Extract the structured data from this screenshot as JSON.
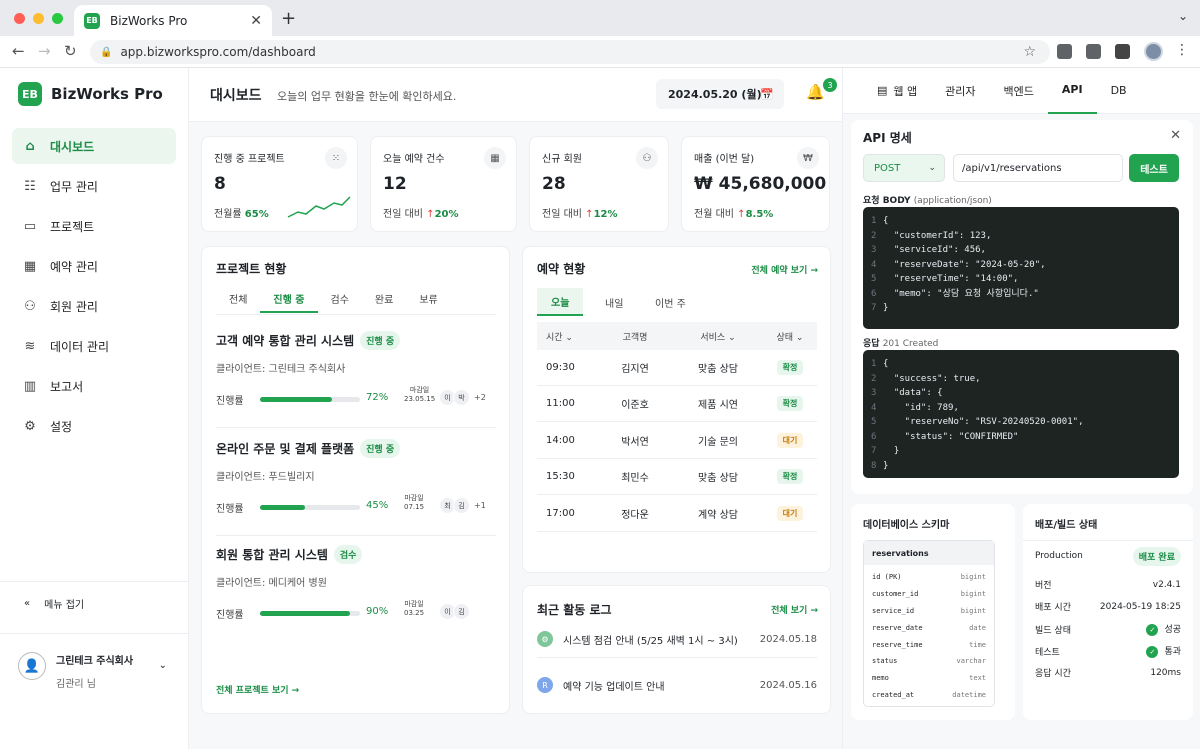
{
  "browser": {
    "tab_title": "BizWorks Pro",
    "url": "app.bizworkspro.com/dashboard"
  },
  "sidebar": {
    "brand": "BizWorks Pro",
    "brand_mark": "EB",
    "items": [
      {
        "label": "대시보드",
        "icon": "home-icon",
        "active": true
      },
      {
        "label": "업무 관리",
        "icon": "clipboard-icon"
      },
      {
        "label": "프로젝트",
        "icon": "folder-icon"
      },
      {
        "label": "예약 관리",
        "icon": "calendar-icon"
      },
      {
        "label": "회원 관리",
        "icon": "users-icon"
      },
      {
        "label": "데이터 관리",
        "icon": "database-icon"
      },
      {
        "label": "보고서",
        "icon": "chart-icon"
      },
      {
        "label": "설정",
        "icon": "gear-icon"
      }
    ],
    "collapse_label": "메뉴 접기",
    "company": "그린테크 주식회사",
    "user": "김관리 님"
  },
  "header": {
    "title": "대시보드",
    "subtitle": "오늘의 업무 현황을 한눈에 확인하세요.",
    "date": "2024.05.20 (월)",
    "notifications": "3"
  },
  "stats": [
    {
      "label": "진행 중 프로젝트",
      "value": "8",
      "cmp_label": "전월률",
      "cmp_value": "65%",
      "trend_up": false
    },
    {
      "label": "오늘 예약 건수",
      "value": "12",
      "cmp_label": "전일 대비",
      "cmp_value": "20%",
      "trend_up": true
    },
    {
      "label": "신규 회원",
      "value": "28",
      "cmp_label": "전일 대비",
      "cmp_value": "12%",
      "trend_up": true
    },
    {
      "label": "매출 (이번 달)",
      "value": "₩ 45,680,000",
      "cmp_label": "전월 대비",
      "cmp_value": "8.5%",
      "trend_up": true
    }
  ],
  "projects": {
    "title": "프로젝트 현황",
    "tabs": [
      "전체",
      "진행 중",
      "검수",
      "완료",
      "보류"
    ],
    "active_tab": 1,
    "progress_label": "진행률",
    "due_label": "마감일",
    "items": [
      {
        "name": "고객 예약 통합 관리 시스템",
        "status": "진행 중",
        "client": "클라이언트: 그린테크 주식회사",
        "progress": 72,
        "progress_text": "72%",
        "due": "23.05.15",
        "members": [
          "이",
          "박"
        ],
        "more": "+2"
      },
      {
        "name": "온라인 주문 및 결제 플랫폼",
        "status": "진행 중",
        "client": "클라이언트: 푸드빌리지",
        "progress": 45,
        "progress_text": "45%",
        "due": "07.15",
        "members": [
          "최",
          "김"
        ],
        "more": "+1"
      },
      {
        "name": "회원 통합 관리 시스템",
        "status": "검수",
        "client": "클라이언트: 메디케어 병원",
        "progress": 90,
        "progress_text": "90%",
        "due": "03.25",
        "members": [
          "이",
          "김"
        ],
        "more": ""
      }
    ],
    "view_all": "전체 프로젝트 보기 →"
  },
  "reservations": {
    "title": "예약 현황",
    "view_all": "전체 예약 보기 →",
    "tabs": [
      "오늘",
      "내일",
      "이번 주"
    ],
    "columns": [
      "시간 ⌄",
      "고객명",
      "서비스 ⌄",
      "상태 ⌄"
    ],
    "rows": [
      {
        "time": "09:30",
        "name": "김지연",
        "service": "맞춤 상담",
        "status": "확정"
      },
      {
        "time": "11:00",
        "name": "이준호",
        "service": "제품 시연",
        "status": "확정"
      },
      {
        "time": "14:00",
        "name": "박서연",
        "service": "기술 문의",
        "status": "대기"
      },
      {
        "time": "15:30",
        "name": "최민수",
        "service": "맞춤 상담",
        "status": "확정"
      },
      {
        "time": "17:00",
        "name": "정다운",
        "service": "계약 상담",
        "status": "대기"
      }
    ]
  },
  "activity": {
    "title": "최근 활동 로그",
    "view_all": "전체 보기 →",
    "items": [
      {
        "text": "시스템 점검 안내 (5/25 새벽 1시 ~ 3시)",
        "date": "2024.05.18",
        "badge": "⚙"
      },
      {
        "text": "예약 기능 업데이트 안내",
        "date": "2024.05.16",
        "badge": "R"
      }
    ]
  },
  "right_tabs": [
    "웹 앱",
    "관리자",
    "백엔드",
    "API",
    "DB"
  ],
  "api": {
    "title": "API 명세",
    "method": "POST",
    "path": "/api/v1/reservations",
    "test": "테스트",
    "request_label": "요청 BODY",
    "request_type": "(application/json)",
    "response_label": "응답",
    "response_status": "201 Created",
    "request_lines": [
      "{",
      "  \"customerId\": 123,",
      "  \"serviceId\": 456,",
      "  \"reserveDate\": \"2024-05-20\",",
      "  \"reserveTime\": \"14:00\",",
      "  \"memo\": \"상담 요청 사항입니다.\"",
      "}"
    ],
    "response_lines": [
      "{",
      "  \"success\": true,",
      "  \"data\": {",
      "    \"id\": 789,",
      "    \"reserveNo\": \"RSV-20240520-0001\",",
      "    \"status\": \"CONFIRMED\"",
      "  }",
      "}"
    ]
  },
  "db": {
    "title": "데이터베이스 스키마",
    "table": "reservations",
    "fields": [
      {
        "name": "id (PK)",
        "type": "bigint"
      },
      {
        "name": "customer_id",
        "type": "bigint"
      },
      {
        "name": "service_id",
        "type": "bigint"
      },
      {
        "name": "reserve_date",
        "type": "date"
      },
      {
        "name": "reserve_time",
        "type": "time"
      },
      {
        "name": "status",
        "type": "varchar"
      },
      {
        "name": "memo",
        "type": "text"
      },
      {
        "name": "created_at",
        "type": "datetime"
      }
    ]
  },
  "deploy": {
    "title": "배포/빌드 상태",
    "env": "Production",
    "env_badge": "배포 완료",
    "version_label": "버전",
    "version": "v2.4.1",
    "time_label": "배포 시간",
    "time": "2024-05-19 18:25",
    "build_label": "빌드 상태",
    "build": "성공",
    "test_label": "테스트",
    "test": "통과",
    "resp_label": "응답 시간",
    "resp": "120ms"
  }
}
